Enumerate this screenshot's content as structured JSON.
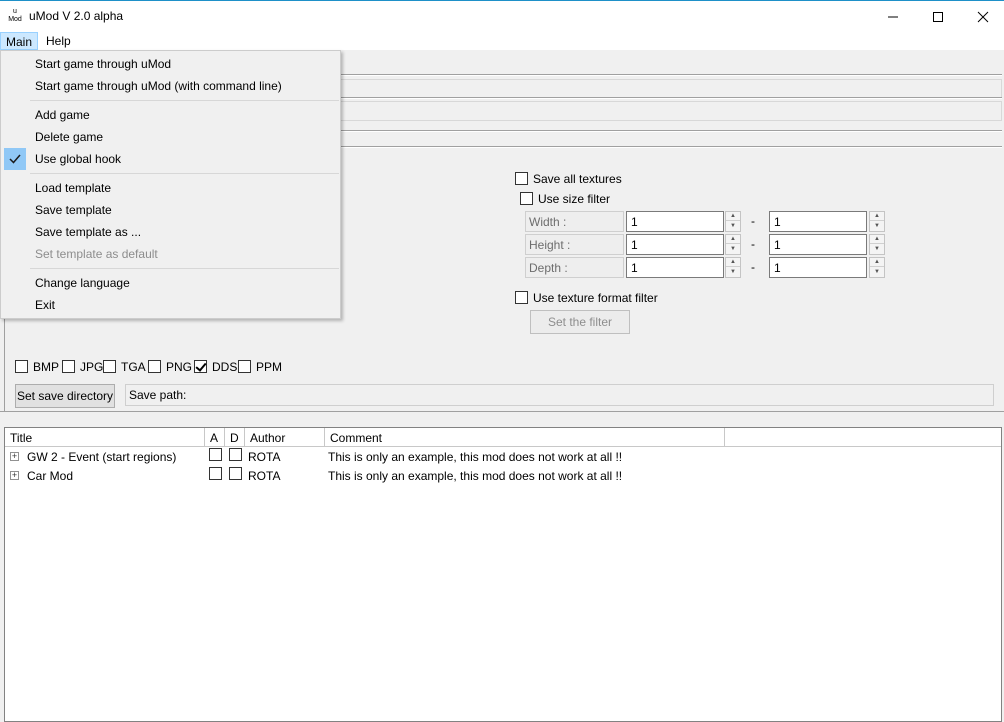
{
  "window": {
    "app_icon_text_top": "u",
    "app_icon_text_bottom": "Mod",
    "title": "uMod V 2.0 alpha"
  },
  "menubar": {
    "main": "Main",
    "help": "Help"
  },
  "main_menu": {
    "start_game": "Start game through uMod",
    "start_game_cmd": "Start game through uMod (with command line)",
    "add_game": "Add game",
    "delete_game": "Delete game",
    "use_global_hook": "Use global hook",
    "use_global_hook_checked": true,
    "load_template": "Load template",
    "save_template": "Save template",
    "save_template_as": "Save template as ...",
    "set_template_default": "Set template as default",
    "change_language": "Change language",
    "exit": "Exit"
  },
  "texture_options": {
    "save_all_textures": "Save all textures",
    "use_size_filter": "Use size filter",
    "width_label": "Width :",
    "height_label": "Height :",
    "depth_label": "Depth :",
    "width_min": "1",
    "width_max": "1",
    "height_min": "1",
    "height_max": "1",
    "depth_min": "1",
    "depth_max": "1",
    "range_sep": "-",
    "use_format_filter": "Use texture format filter",
    "set_filter_button": "Set the filter"
  },
  "formats": {
    "bmp": "BMP",
    "jpg": "JPG",
    "tga": "TGA",
    "png": "PNG",
    "dds": "DDS",
    "ppm": "PPM",
    "dds_checked": true
  },
  "save": {
    "set_dir_button": "Set save directory",
    "path_label": "Save path:"
  },
  "mod_list": {
    "headers": {
      "title": "Title",
      "a": "A",
      "d": "D",
      "author": "Author",
      "comment": "Comment"
    },
    "rows": [
      {
        "title": "GW 2 - Event  (start regions)",
        "author": "ROTA",
        "comment": "This is only an example, this mod does not work at all !!"
      },
      {
        "title": "Car Mod",
        "author": "ROTA",
        "comment": "This is only an example, this mod does not work at all !!"
      }
    ]
  },
  "colors": {
    "menu_highlight": "#cce8ff",
    "check_highlight": "#90c8f6",
    "titlebar_accent": "#1e90c8"
  },
  "icons": {
    "minimize": "minimize-icon",
    "maximize": "maximize-icon",
    "close": "close-icon",
    "check": "check-icon",
    "expand": "plus-expand-icon"
  }
}
